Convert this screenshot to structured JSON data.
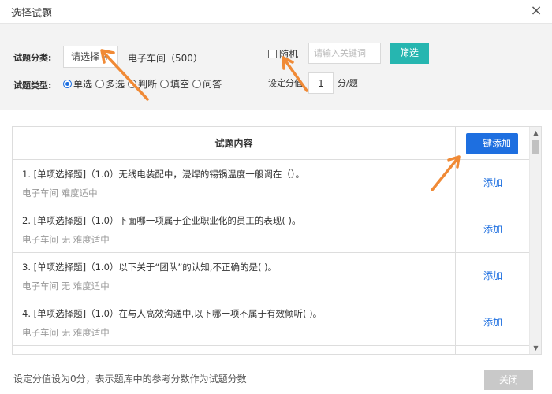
{
  "dialog": {
    "title": "选择试题",
    "close_glyph": "×"
  },
  "filter": {
    "category_label": "试题分类:",
    "category_button": "请选择 +",
    "category_selected": "电子车间（500）",
    "type_label": "试题类型:",
    "types": [
      {
        "label": "单选",
        "checked": true
      },
      {
        "label": "多选",
        "checked": false
      },
      {
        "label": "判断",
        "checked": false
      },
      {
        "label": "填空",
        "checked": false
      },
      {
        "label": "问答",
        "checked": false
      }
    ],
    "random_label": "随机",
    "keyword_placeholder": "请输入关键词",
    "filter_button": "筛选",
    "score_label": "设定分值",
    "score_value": "1",
    "score_unit": "分/题"
  },
  "table": {
    "header_content": "试题内容",
    "add_all_button": "一键添加",
    "add_label": "添加",
    "rows": [
      {
        "text": "1. [单项选择题]（1.0）无线电装配中，浸焊的锡锅温度一般调在（）。",
        "meta": "电子车间    难度适中"
      },
      {
        "text": "2. [单项选择题]（1.0）下面哪一项属于企业职业化的员工的表现( )。",
        "meta": "电子车间  无  难度适中"
      },
      {
        "text": "3. [单项选择题]（1.0）以下关于“团队”的认知,不正确的是( )。",
        "meta": "电子车间  无  难度适中"
      },
      {
        "text": "4. [单项选择题]（1.0）在与人高效沟通中,以下哪一项不属于有效倾听( )。",
        "meta": "电子车间  无  难度适中"
      }
    ]
  },
  "footer": {
    "note": "设定分值设为0分，表示题库中的参考分数作为试题分数",
    "close_button": "关闭"
  },
  "colors": {
    "primary": "#1e6fe0",
    "teal": "#26b6b0",
    "arrow": "#f08a36"
  }
}
